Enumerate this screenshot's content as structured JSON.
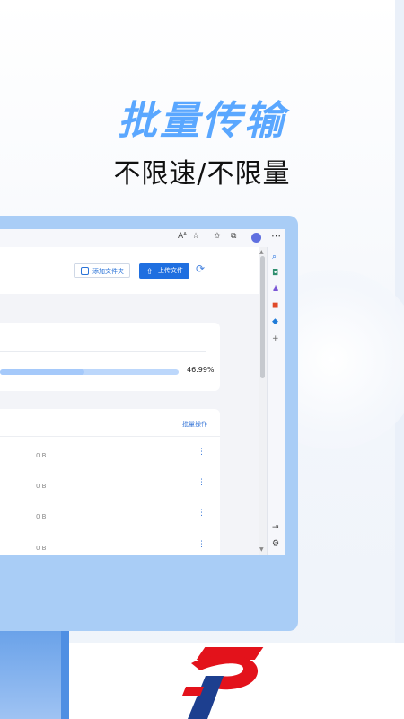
{
  "headline": "批量传输",
  "subheadline": "不限速/不限量",
  "browser": {
    "topbar_icons": [
      "reader-mode-icon",
      "favorite-icon",
      "favorites-star-icon",
      "collections-icon",
      "profile-avatar-icon",
      "more-icon"
    ],
    "reader_mode_glyph": "Aᴬ",
    "more_glyph": "⋯"
  },
  "app": {
    "add_folder_label": "添加文件夹",
    "upload_label": "上传文件",
    "progress": {
      "value": 0.4699,
      "label": "46.99%"
    },
    "batch_label": "批量操作",
    "files": [
      {
        "size": "0 B"
      },
      {
        "size": "0 B"
      },
      {
        "size": "0 B"
      },
      {
        "size": "0 B"
      }
    ],
    "more_glyph": "⋮"
  },
  "side_panel_icons": [
    "search-icon",
    "shopping-icon",
    "people-icon",
    "office-icon",
    "outlook-icon",
    "add-icon",
    "split-screen-icon",
    "settings-icon"
  ],
  "colors": {
    "headline": "#5aa7ff",
    "accent": "#1f6fe0",
    "monitor": "#a9cdf6",
    "logo_red": "#e3121b",
    "logo_blue": "#1d3f8f"
  }
}
